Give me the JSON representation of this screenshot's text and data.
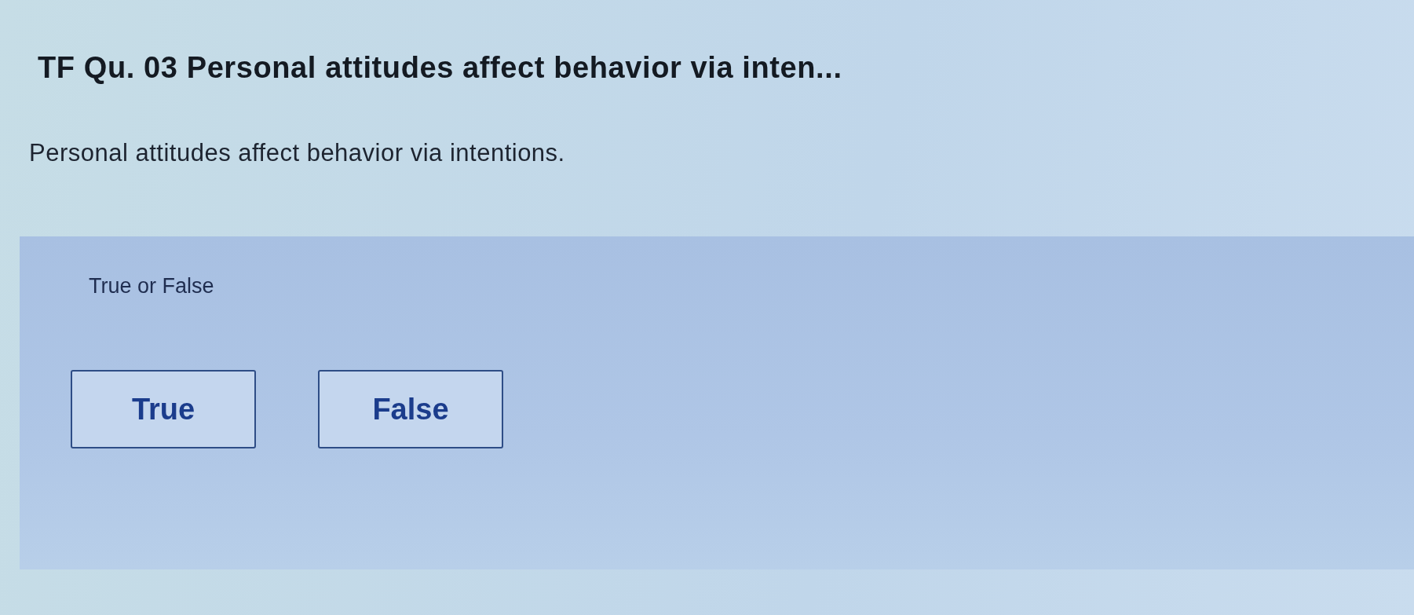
{
  "question": {
    "title": "TF Qu. 03 Personal attitudes affect behavior via inten...",
    "prompt": "Personal attitudes affect behavior via intentions."
  },
  "answer_panel": {
    "label": "True or False",
    "options": [
      {
        "label": "True"
      },
      {
        "label": "False"
      }
    ]
  }
}
